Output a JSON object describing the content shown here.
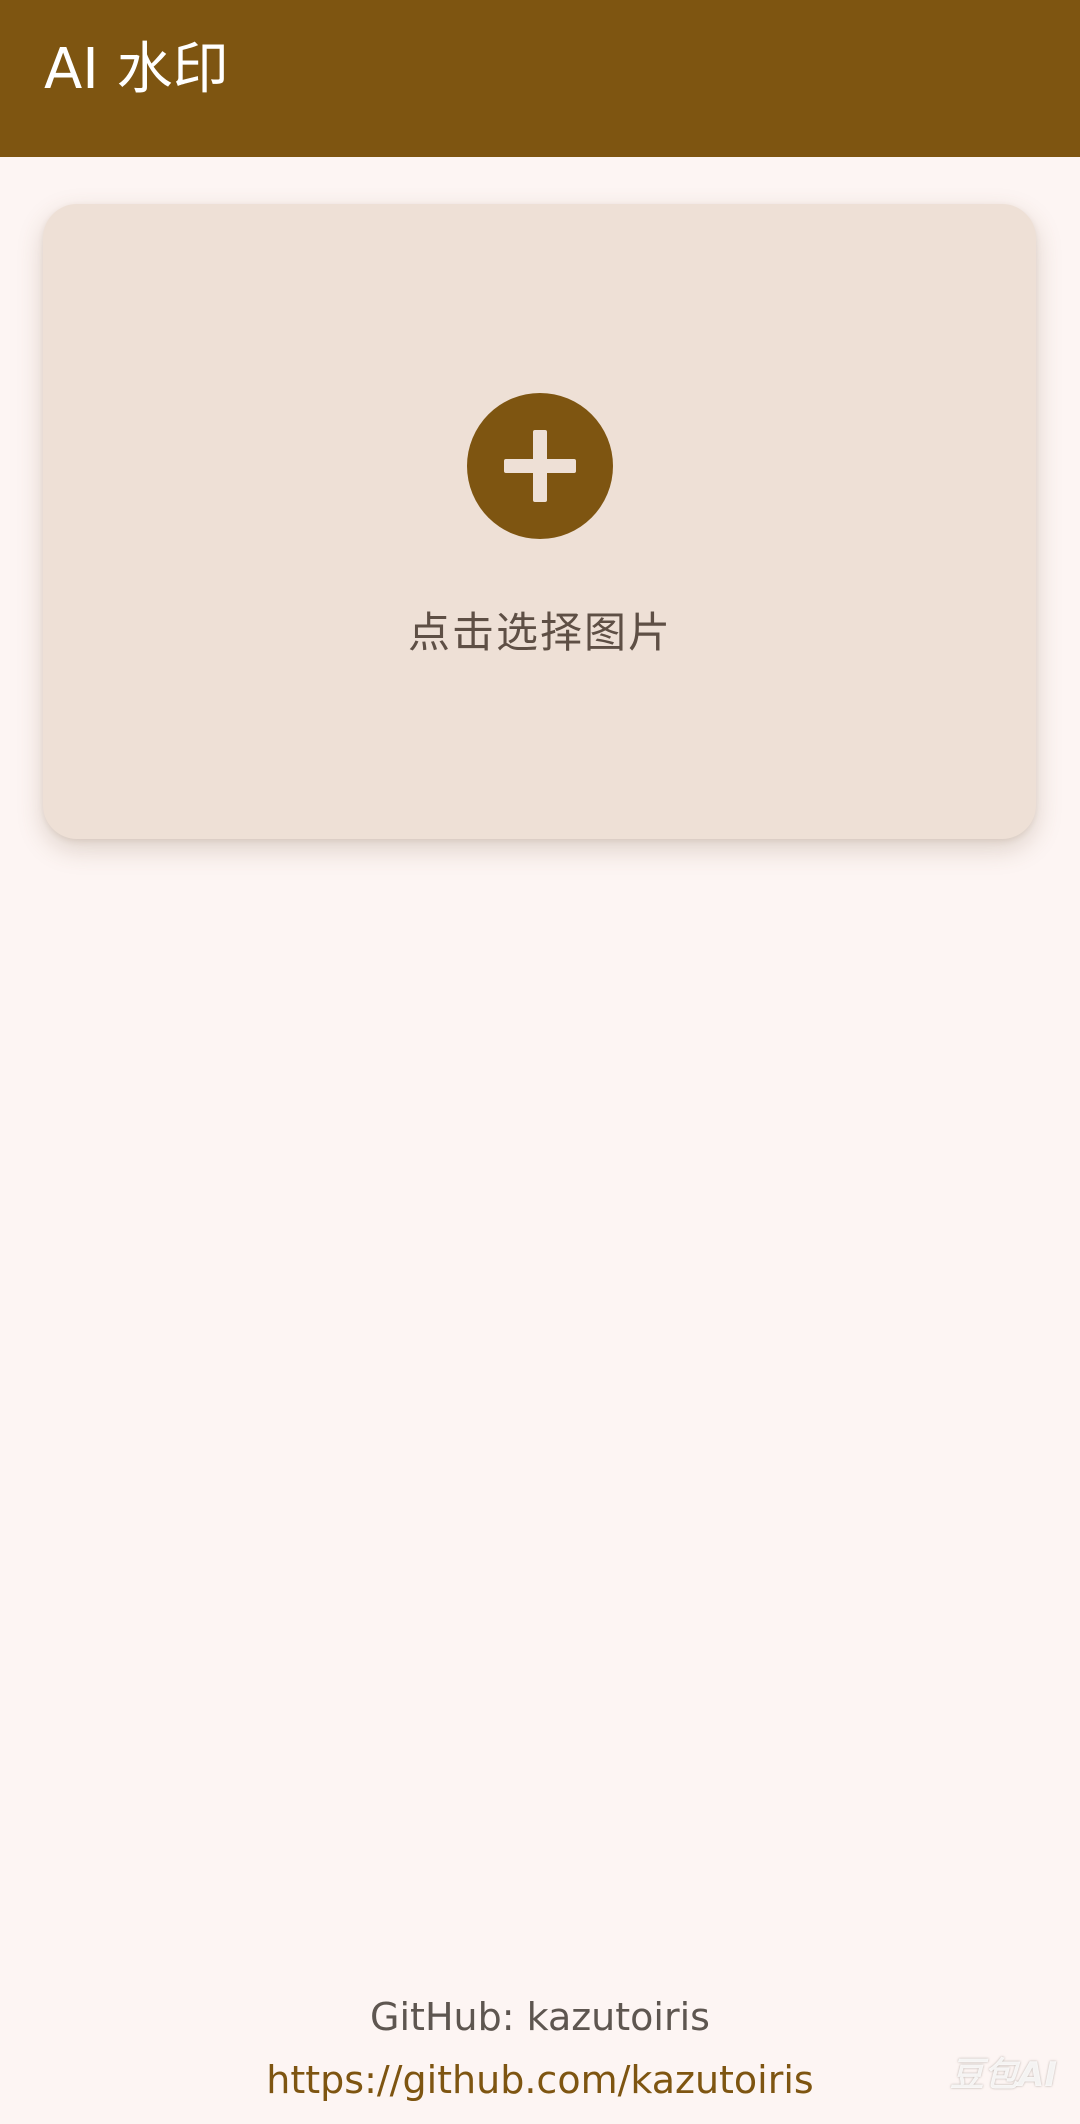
{
  "app_bar": {
    "title": "AI 水印",
    "color": "#7E5511"
  },
  "picker": {
    "icon": "add-circle-icon",
    "label": "点击选择图片"
  },
  "footer": {
    "github_text": "GitHub: kazutoiris",
    "link_text": "https://github.com/kazutoiris"
  },
  "watermark": "豆包AI",
  "colors": {
    "accent": "#7E5511",
    "background": "#FDF5F3",
    "card": "#EEE0D6"
  }
}
